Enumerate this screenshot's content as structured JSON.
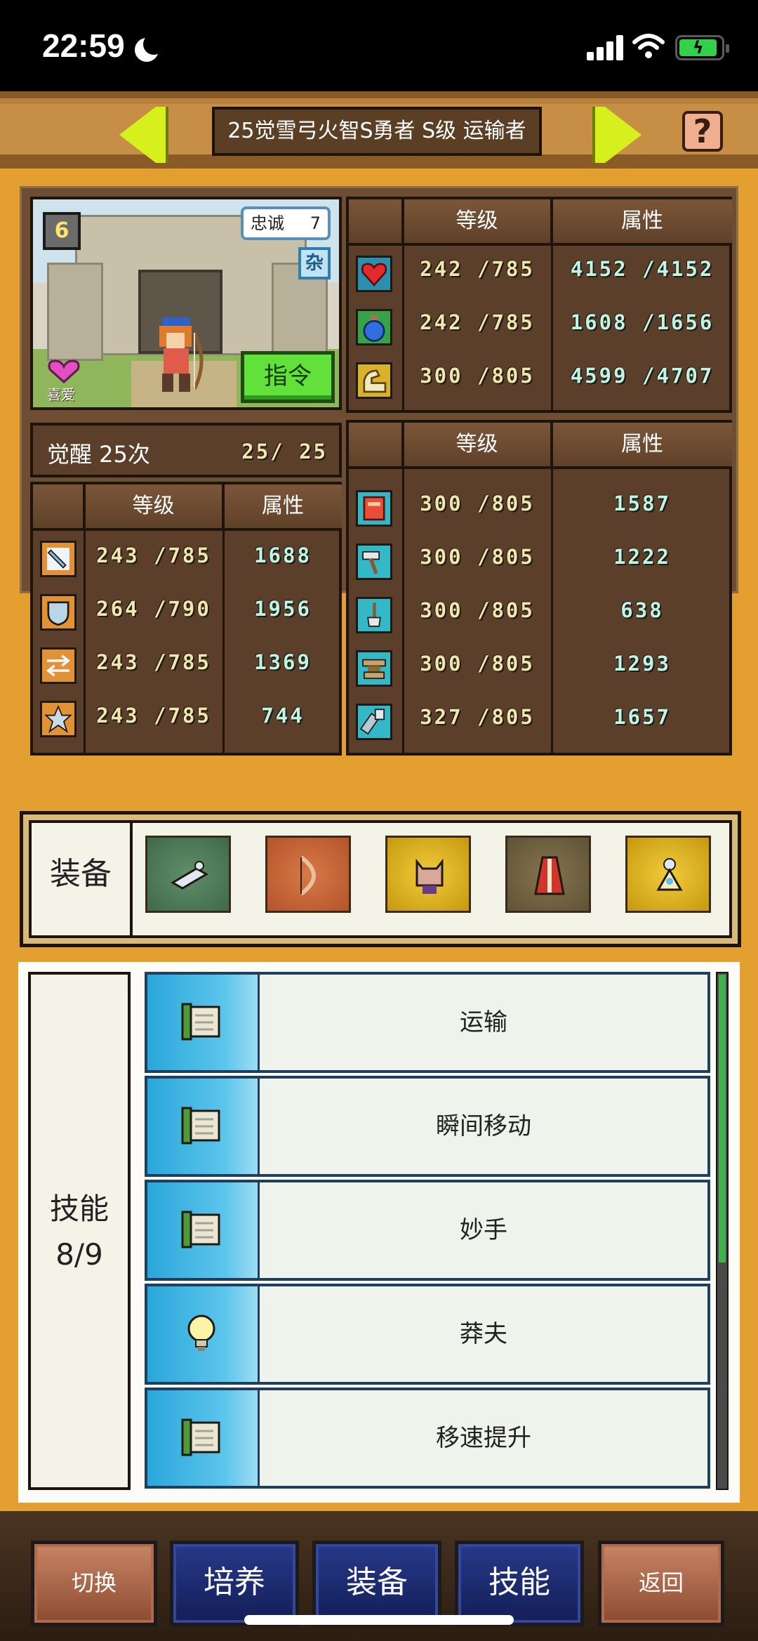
{
  "status_bar": {
    "time": "22:59"
  },
  "header": {
    "title": "25觉雪弓火智S勇者 S级 运输者"
  },
  "portrait": {
    "loyalty_label": "忠诚",
    "loyalty_value": "7",
    "misc_badge": "杂",
    "favorite_label": "喜爱",
    "command_button": "指令"
  },
  "vitals_table": {
    "headers": [
      "等级",
      "属性"
    ],
    "rows": [
      {
        "icon": "heart-icon",
        "level": "242 /785",
        "attr": "4152 /4152"
      },
      {
        "icon": "potion-icon",
        "level": "242 /785",
        "attr": "1608 /1656"
      },
      {
        "icon": "stamina-icon",
        "level": "300 /805",
        "attr": "4599 /4707"
      }
    ]
  },
  "awakening": {
    "label": "觉醒 25次",
    "count": "25/  25"
  },
  "combat_table": {
    "headers": [
      "等级",
      "属性"
    ],
    "rows": [
      {
        "icon": "sword-icon",
        "level": "243 /785",
        "attr": "1688"
      },
      {
        "icon": "shield-icon",
        "level": "264 /790",
        "attr": "1956"
      },
      {
        "icon": "agility-arrows-icon",
        "level": "243 /785",
        "attr": "1369"
      },
      {
        "icon": "star-icon",
        "level": "243 /785",
        "attr": "744"
      }
    ]
  },
  "work_table": {
    "headers": [
      "等级",
      "属性"
    ],
    "rows": [
      {
        "icon": "book-icon",
        "level": "300 /805",
        "attr": "1587"
      },
      {
        "icon": "hammer-icon",
        "level": "300 /805",
        "attr": "1222"
      },
      {
        "icon": "shovel-icon",
        "level": "300 /805",
        "attr": "638"
      },
      {
        "icon": "anvil-icon",
        "level": "300 /805",
        "attr": "1293"
      },
      {
        "icon": "hose-icon",
        "level": "327 /805",
        "attr": "1657"
      }
    ]
  },
  "equipment": {
    "label": "装备",
    "slots": [
      {
        "icon": "snow-bow-icon",
        "bg": "#3f6a4a"
      },
      {
        "icon": "bow-icon",
        "bg": "#b5532a"
      },
      {
        "icon": "cat-hood-icon",
        "bg": "#d4a418"
      },
      {
        "icon": "red-robe-icon",
        "bg": "#6a5a3d"
      },
      {
        "icon": "amulet-icon",
        "bg": "#d4a418"
      }
    ]
  },
  "skills": {
    "label": "技能",
    "count": "8/9",
    "items": [
      {
        "name": "运输",
        "icon": "scroll-icon"
      },
      {
        "name": "瞬间移动",
        "icon": "scroll-icon"
      },
      {
        "name": "妙手",
        "icon": "scroll-icon"
      },
      {
        "name": "莽夫",
        "icon": "lightbulb-icon"
      },
      {
        "name": "移速提升",
        "icon": "scroll-icon"
      }
    ]
  },
  "bottom_nav": {
    "switch": "切换",
    "train": "培养",
    "equip": "装备",
    "skills": "技能",
    "back": "返回"
  }
}
